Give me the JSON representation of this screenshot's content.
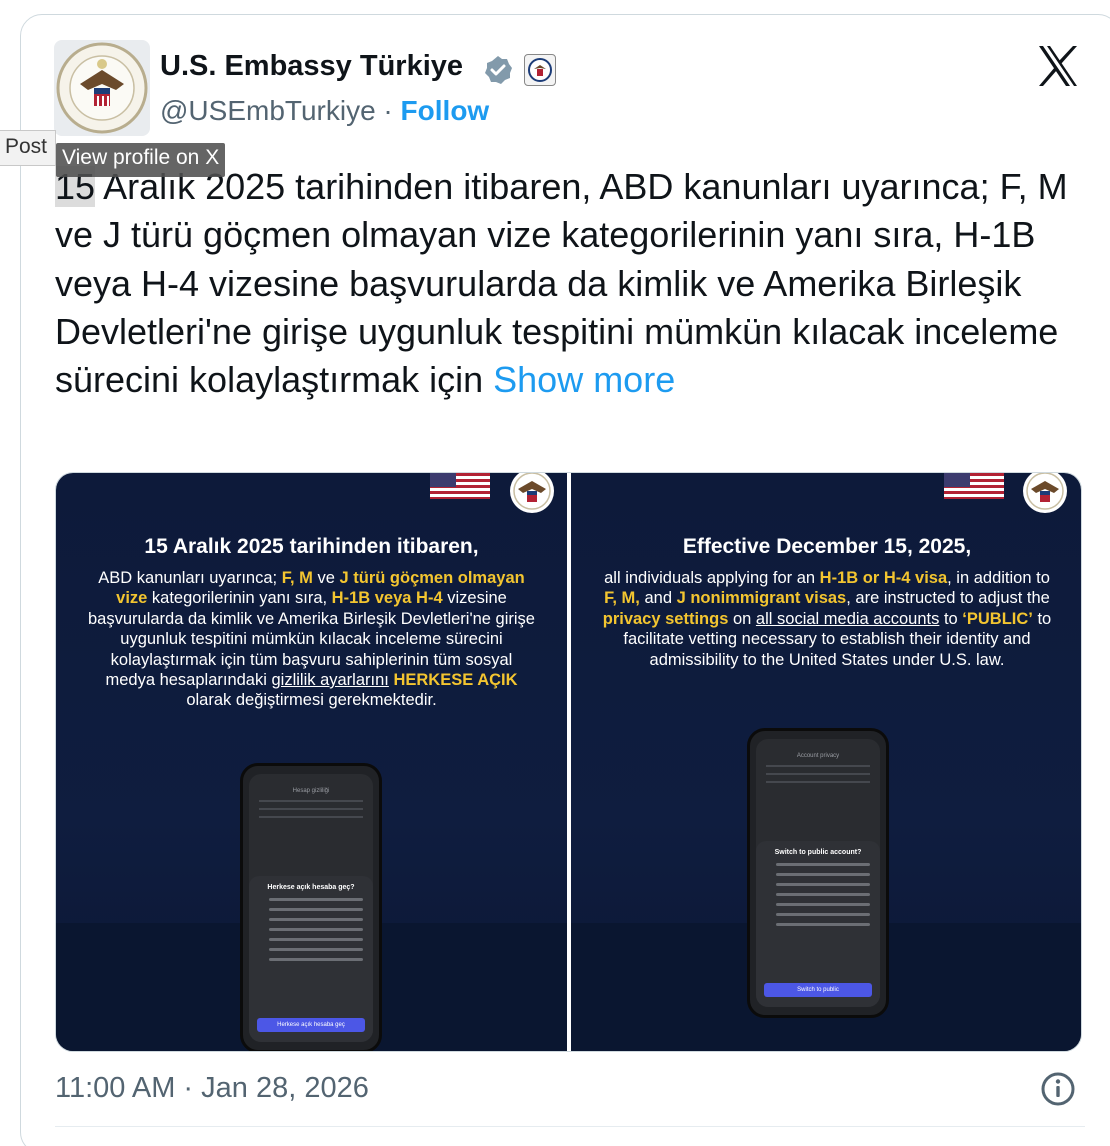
{
  "tweet": {
    "author_name": "U.S. Embassy Türkiye",
    "handle": "@USEmbTurkiye",
    "separator": " · ",
    "follow_label": "Follow",
    "text_first": "15",
    "text_rest": " Aralık 2025 tarihinden itibaren, ABD kanunları uyarınca; F, M ve J türü göçmen olmayan vize kategorilerinin yanı sıra, H-1B veya H-4 vizesine başvurularda da kimlik ve Amerika Birleşik Devletleri'ne girişe uygunluk tespitini mümkün kılacak inceleme sürecini kolaylaştırmak için ",
    "show_more_label": "Show more",
    "timestamp": "11:00 AM · Jan 28, 2026"
  },
  "overlay": {
    "post_tag": "Post",
    "tooltip": "View profile on X"
  },
  "media": {
    "left": {
      "title": "15 Aralık 2025 tarihinden itibaren,",
      "t1": "ABD kanunları uyarınca; ",
      "h1": "F, M",
      "t2": " ve ",
      "h2": "J türü göçmen olmayan vize",
      "t3": " kategorilerinin yanı sıra, ",
      "h3": "H-1B veya H-4",
      "t4": " vizesine başvurularda da kimlik ve Amerika Birleşik Devletleri'ne girişe uygunluk tespitini mümkün kılacak inceleme sürecini kolaylaştırmak için tüm başvuru sahiplerinin tüm sosyal medya hesaplarındaki ",
      "u1": "gizlilik ayarlarını",
      "t5": " ",
      "h4": "HERKESE AÇIK",
      "t6": " olarak değiştirmesi gerekmektedir.",
      "phone_header": "Hesap gizliliği",
      "phone_sheet_title": "Herkese açık hesaba geç?",
      "phone_button": "Herkese açık hesaba geç"
    },
    "right": {
      "title": "Effective December 15, 2025,",
      "t1": "all individuals applying for an ",
      "h1": "H-1B or H-4 visa",
      "t2": ", in addition to ",
      "h2": "F, M,",
      "t3": " and ",
      "h3": "J nonimmigrant visas",
      "t4": ", are instructed to adjust the ",
      "h4": "privacy settings",
      "t5": " on ",
      "u1": "all social media accounts",
      "t6": " to ",
      "h5": "‘PUBLIC’",
      "t7": " to facilitate vetting necessary to establish their identity and admissibility to the United States under U.S. law.",
      "phone_header": "Account privacy",
      "phone_sheet_title": "Switch to public account?",
      "phone_button": "Switch to public"
    }
  },
  "icons": {
    "verified": "verified-badge-icon",
    "logo": "x-logo-icon",
    "info": "info-icon"
  },
  "colors": {
    "link": "#1d9bf0",
    "highlight": "#f3c530",
    "panel_bg": "#0d1a3a"
  }
}
